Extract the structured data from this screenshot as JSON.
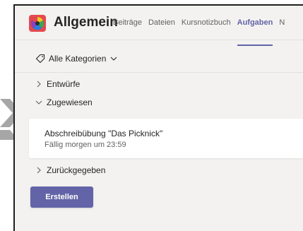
{
  "header": {
    "channel_title": "Allgemein",
    "tabs": [
      {
        "label": "Beiträge"
      },
      {
        "label": "Dateien"
      },
      {
        "label": "Kursnotizbuch"
      },
      {
        "label": "Aufgaben",
        "active": true
      },
      {
        "label": "N"
      }
    ]
  },
  "filter": {
    "category_label": "Alle Kategorien"
  },
  "sections": {
    "drafts": "Entwürfe",
    "assigned": "Zugewiesen",
    "returned": "Zurückgegeben"
  },
  "assignment": {
    "title": "Abschreibübung \"Das Picknick\"",
    "due": "Fällig morgen um 23:59"
  },
  "actions": {
    "create_label": "Erstellen"
  },
  "colors": {
    "accent": "#6264a7",
    "background": "#f3f2f1",
    "text": "#252423",
    "muted_text": "#616161",
    "pointer_arrow": "#a6a6a6"
  },
  "icons": {
    "app": "class-team-icon",
    "category": "tag-icon",
    "collapsed": "chevron-right-icon",
    "expanded": "chevron-down-icon",
    "pointer": "arrow-pointer-icon"
  }
}
